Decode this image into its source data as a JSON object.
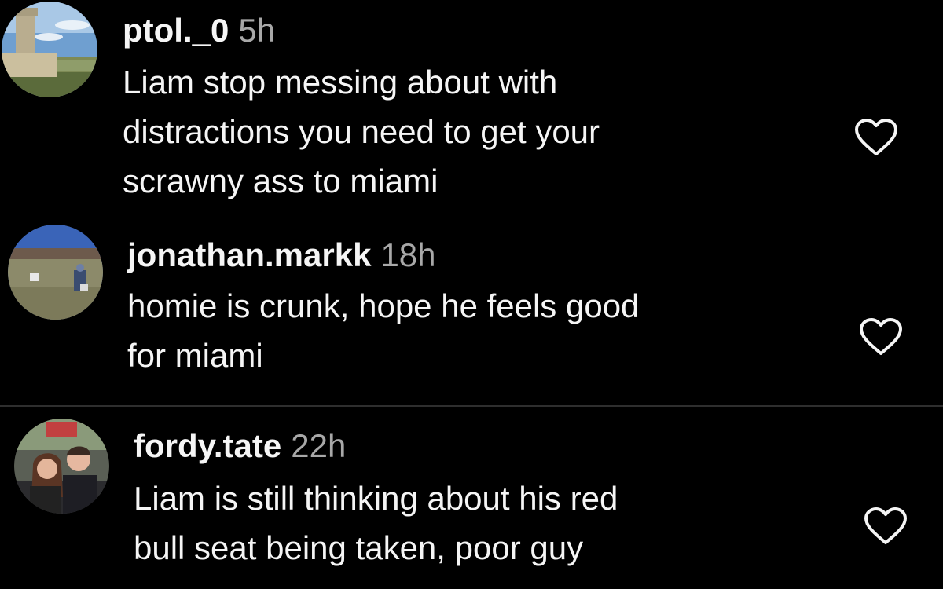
{
  "comments": [
    {
      "username": "ptol._0",
      "time": "5h",
      "lines": [
        "Liam stop messing about with",
        "distractions you need to get your",
        "scrawny ass to miami"
      ],
      "avatar": "castle-landscape-avatar"
    },
    {
      "username": "jonathan.markk",
      "time": "18h",
      "lines": [
        "homie is crunk, hope he feels good",
        "for miami"
      ],
      "avatar": "field-dog-avatar"
    },
    {
      "username": "fordy.tate",
      "time": "22h",
      "lines": [
        "Liam is still thinking about his red",
        "bull seat being taken, poor guy"
      ],
      "avatar": "couple-selfie-avatar"
    }
  ],
  "icons": {
    "like": "heart-outline-icon"
  },
  "colors": {
    "background": "#000000",
    "text": "#f5f5f5",
    "timestamp": "#a8a8a8",
    "divider": "#2e2e2e"
  }
}
